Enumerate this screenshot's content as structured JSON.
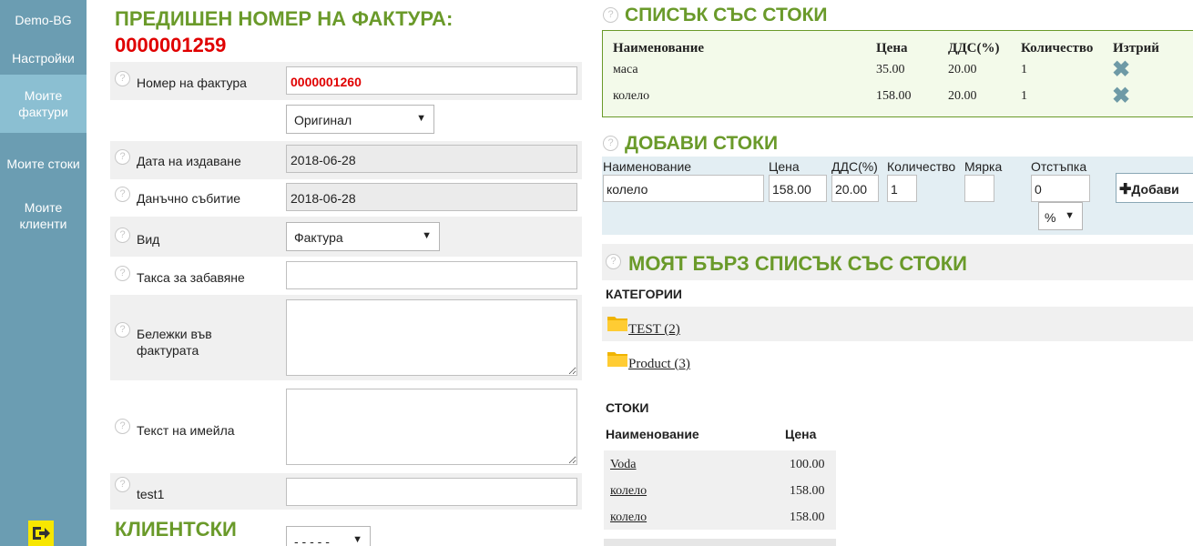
{
  "sidebar": {
    "items": [
      {
        "label": "Demo-BG"
      },
      {
        "label": "Настройки"
      },
      {
        "label": "Моите фактури"
      },
      {
        "label": "Моите стоки"
      },
      {
        "label": "Моите клиенти"
      }
    ]
  },
  "left": {
    "prev_title": "ПРЕДИШЕН НОМЕР НА ФАКТУРА:",
    "prev_number": "0000001259",
    "invoice_number_label": "Номер на фактура",
    "invoice_number_value": "0000001260",
    "copy_select": "Оригинал",
    "issue_date_label": "Дата на издаване",
    "issue_date_value": "2018-06-28",
    "tax_event_label": "Данъчно събитие",
    "tax_event_value": "2018-06-28",
    "type_label": "Вид",
    "type_select": "Фактура",
    "late_fee_label": "Такса за забавяне",
    "notes_label": "Бележки във фактурата",
    "email_text_label": "Текст на имейла",
    "test1_label": "test1",
    "clients_title": "КЛИЕНТСКИ",
    "client_select": "- - - - -"
  },
  "goods_list": {
    "title": "СПИСЪК СЪС СТОКИ",
    "headers": [
      "Наименование",
      "Цена",
      "ДДС(%)",
      "Количество",
      "Изтрий"
    ],
    "rows": [
      {
        "name": "маса",
        "price": "35.00",
        "vat": "20.00",
        "qty": "1"
      },
      {
        "name": "колело",
        "price": "158.00",
        "vat": "20.00",
        "qty": "1"
      }
    ]
  },
  "add_goods": {
    "title": "ДОБАВИ СТОКИ",
    "name_label": "Наименование",
    "price_label": "Цена",
    "vat_label": "ДДС(%)",
    "qty_label": "Количество",
    "unit_label": "Мярка",
    "discount_label": "Отстъпка",
    "name_value": "колело",
    "price_value": "158.00",
    "vat_value": "20.00",
    "qty_value": "1",
    "discount_value": "0",
    "discount_unit": "%",
    "add_button": "Добави"
  },
  "quick_list": {
    "title": "МОЯТ БЪРЗ СПИСЪК СЪС СТОКИ",
    "categories_title": "КАТЕГОРИИ",
    "categories": [
      {
        "label": "TEST (2)"
      },
      {
        "label": "Product (3)"
      }
    ],
    "goods_title": "СТОКИ",
    "goods_headers": [
      "Наименование",
      "Цена"
    ],
    "goods": [
      {
        "name": "Voda",
        "price": "100.00"
      },
      {
        "name": "колело",
        "price": "158.00"
      },
      {
        "name": "колело",
        "price": "158.00"
      }
    ]
  }
}
